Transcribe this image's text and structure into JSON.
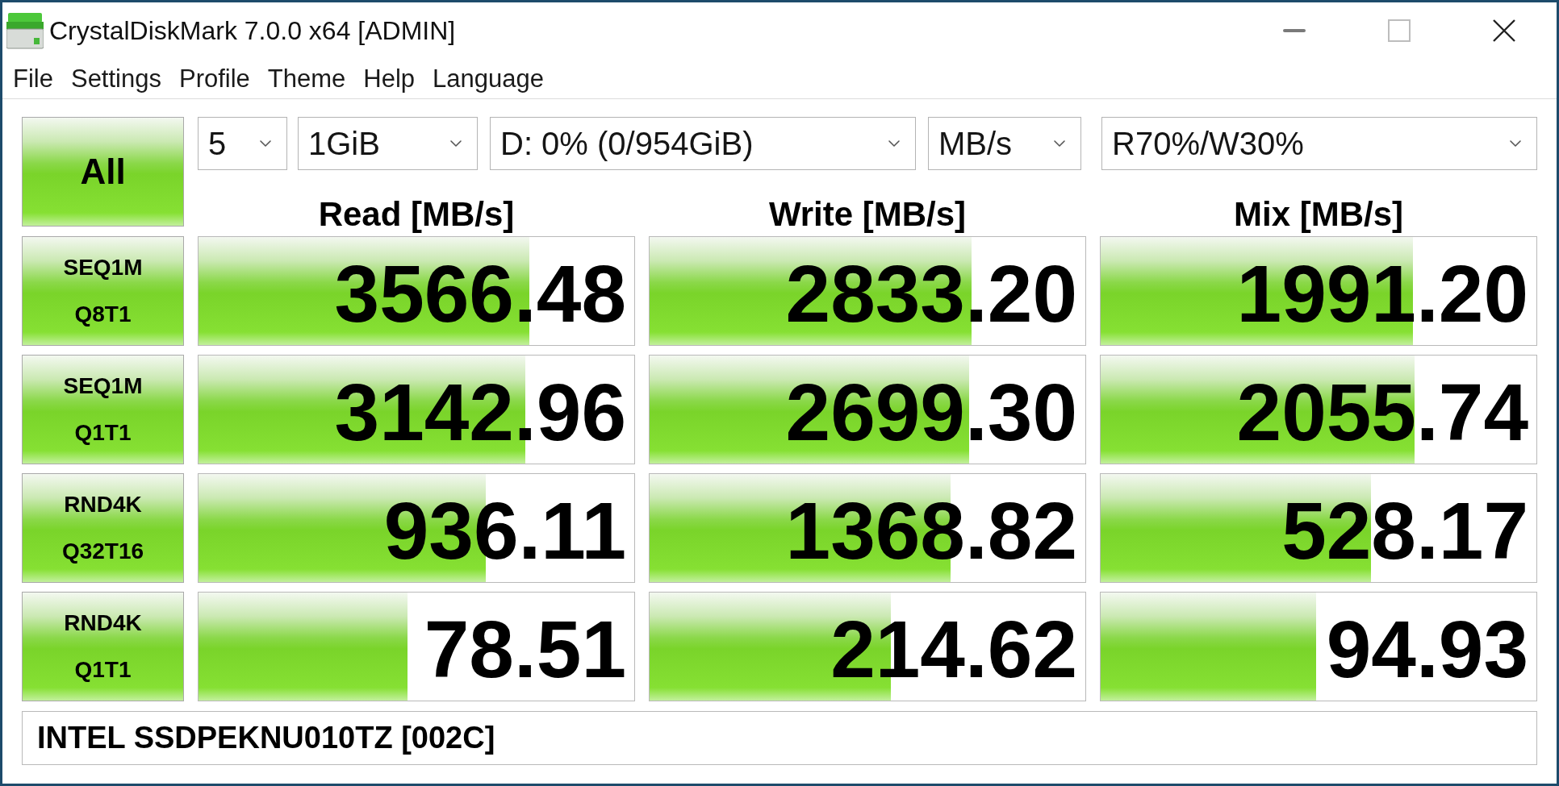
{
  "window": {
    "title": "CrystalDiskMark 7.0.0 x64 [ADMIN]"
  },
  "menu": [
    "File",
    "Settings",
    "Profile",
    "Theme",
    "Help",
    "Language"
  ],
  "all_button": {
    "label": "All"
  },
  "dropdowns": [
    {
      "value": "5"
    },
    {
      "value": "1GiB"
    },
    {
      "value": "D: 0% (0/954GiB)"
    },
    {
      "value": "MB/s"
    },
    {
      "value": "R70%/W30%"
    }
  ],
  "columns": [
    "Read [MB/s]",
    "Write [MB/s]",
    "Mix [MB/s]"
  ],
  "rows": [
    {
      "label_lines": [
        "SEQ1M",
        "Q8T1"
      ],
      "results": [
        {
          "value": "3566.48",
          "level": 0.76
        },
        {
          "value": "2833.20",
          "level": 0.738
        },
        {
          "value": "1991.20",
          "level": 0.716
        }
      ]
    },
    {
      "label_lines": [
        "SEQ1M",
        "Q1T1"
      ],
      "results": [
        {
          "value": "3142.96",
          "level": 0.75
        },
        {
          "value": "2699.30",
          "level": 0.733
        },
        {
          "value": "2055.74",
          "level": 0.72
        }
      ]
    },
    {
      "label_lines": [
        "RND4K",
        "Q32T16"
      ],
      "results": [
        {
          "value": "936.11",
          "level": 0.66
        },
        {
          "value": "1368.82",
          "level": 0.69
        },
        {
          "value": "528.17",
          "level": 0.62
        }
      ]
    },
    {
      "label_lines": [
        "RND4K",
        "Q1T1"
      ],
      "results": [
        {
          "value": "78.51",
          "level": 0.48
        },
        {
          "value": "214.62",
          "level": 0.553
        },
        {
          "value": "94.93",
          "level": 0.494
        }
      ]
    }
  ],
  "drive_name": "INTEL SSDPEKNU010TZ [002C]"
}
